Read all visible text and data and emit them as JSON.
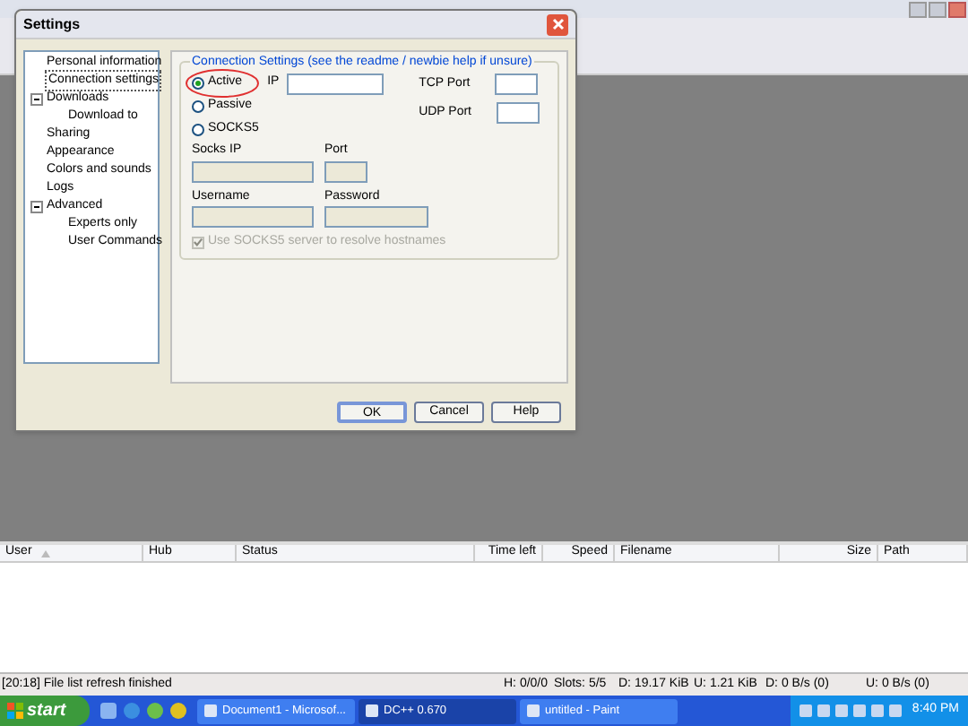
{
  "settings_dialog": {
    "title": "Settings",
    "tree": [
      {
        "label": "Personal information",
        "selected": false
      },
      {
        "label": "Connection settings",
        "selected": true
      },
      {
        "label": "Downloads",
        "selected": false,
        "expanded": true,
        "children": [
          {
            "label": "Download to",
            "selected": false
          }
        ]
      },
      {
        "label": "Sharing",
        "selected": false
      },
      {
        "label": "Appearance",
        "selected": false
      },
      {
        "label": "Colors and sounds",
        "selected": false
      },
      {
        "label": "Logs",
        "selected": false
      },
      {
        "label": "Advanced",
        "selected": false,
        "expanded": true,
        "children": [
          {
            "label": "Experts only",
            "selected": false
          },
          {
            "label": "User Commands",
            "selected": false
          }
        ]
      }
    ],
    "connection_group": {
      "title": "Connection Settings (see the readme / newbie help if unsure)",
      "modes": [
        {
          "label": "Active",
          "selected": true,
          "circled": true
        },
        {
          "label": "Passive",
          "selected": false,
          "circled": false
        },
        {
          "label": "SOCKS5",
          "selected": false,
          "circled": false
        }
      ],
      "ip": {
        "label": "IP",
        "disabled": false
      },
      "tcp_port": {
        "label": "TCP Port",
        "disabled": false
      },
      "udp_port": {
        "label": "UDP Port",
        "disabled": false
      },
      "socks_ip": {
        "label": "Socks IP",
        "disabled": true
      },
      "socks_port": {
        "label": "Port",
        "disabled": true
      },
      "username": {
        "label": "Username",
        "disabled": true
      },
      "password": {
        "label": "Password",
        "disabled": true
      },
      "resolve_checkbox": {
        "label": "Use SOCKS5 server to resolve hostnames",
        "checked": true,
        "disabled": true
      }
    },
    "buttons": [
      {
        "label": "OK",
        "default": true
      },
      {
        "label": "Cancel",
        "default": false
      },
      {
        "label": "Help",
        "default": false
      }
    ]
  },
  "transfers": {
    "columns": [
      {
        "label": "User",
        "right_aligned": false,
        "sorted": true
      },
      {
        "label": "Hub",
        "right_aligned": false,
        "sorted": false
      },
      {
        "label": "Status",
        "right_aligned": false,
        "sorted": false
      },
      {
        "label": "Time left",
        "right_aligned": true,
        "sorted": false
      },
      {
        "label": "Speed",
        "right_aligned": true,
        "sorted": false
      },
      {
        "label": "Filename",
        "right_aligned": false,
        "sorted": false
      },
      {
        "label": "Size",
        "right_aligned": true,
        "sorted": false
      },
      {
        "label": "Path",
        "right_aligned": false,
        "sorted": false
      }
    ]
  },
  "status_bar": [
    "[20:18] File list refresh finished",
    "H: 0/0/0",
    "Slots: 5/5",
    "D: 19.17 KiB",
    "U: 1.21 KiB",
    "D: 0 B/s (0)",
    "U: 0 B/s (0)"
  ],
  "taskbar": {
    "start": "start",
    "tasks": [
      {
        "label": "Document1 - Microsof...",
        "selected": false
      },
      {
        "label": "DC++ 0.670",
        "selected": true
      },
      {
        "label": "untitled - Paint",
        "selected": false
      }
    ],
    "clock": "8:40 PM"
  }
}
